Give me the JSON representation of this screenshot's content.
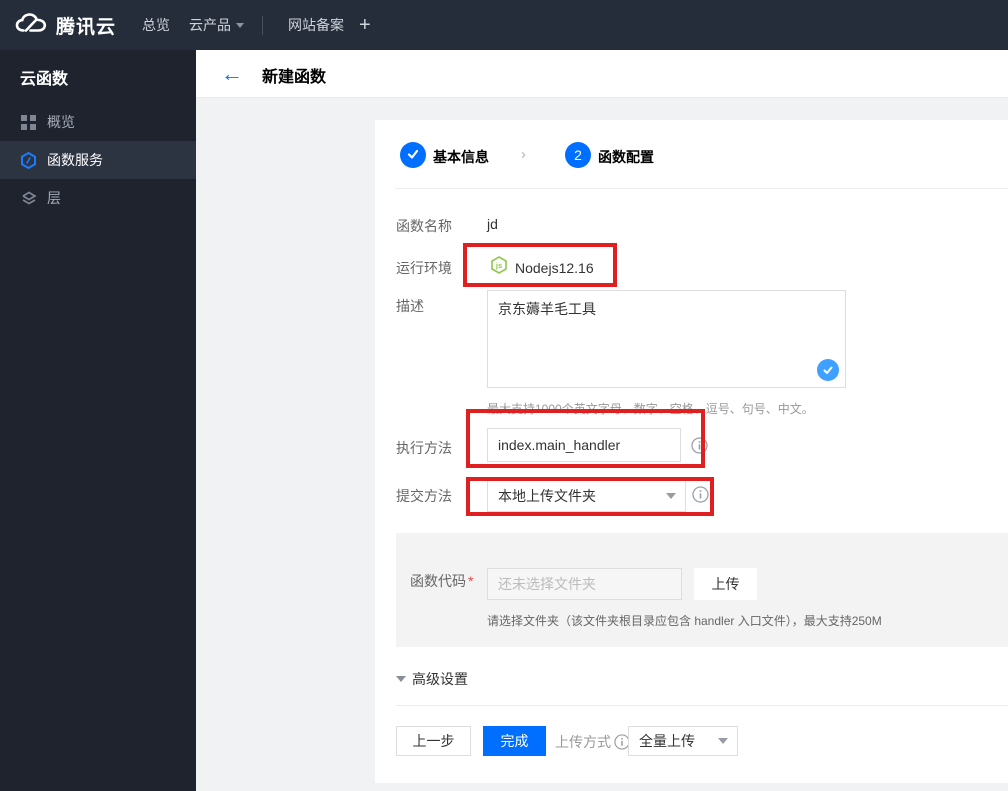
{
  "navbar": {
    "brand": "腾讯云",
    "overview": "总览",
    "cloud_products": "云产品",
    "icp_record": "网站备案",
    "plus": "+"
  },
  "sidebar": {
    "title": "云函数",
    "items": [
      {
        "label": "概览",
        "icon": "grid-icon"
      },
      {
        "label": "函数服务",
        "icon": "function-hexagon-icon",
        "selected": true
      },
      {
        "label": "层",
        "icon": "layers-icon"
      }
    ]
  },
  "header": {
    "back": "←",
    "title": "新建函数"
  },
  "steps": {
    "step1": {
      "label": "基本信息",
      "state": "done"
    },
    "step2": {
      "num": "2",
      "label": "函数配置",
      "state": "active"
    },
    "chevron": "›"
  },
  "form": {
    "function_name": {
      "label": "函数名称",
      "value": "jd"
    },
    "runtime": {
      "label": "运行环境",
      "value": "Nodejs12.16",
      "icon": "nodejs-icon"
    },
    "description": {
      "label": "描述",
      "value": "京东薅羊毛工具",
      "helper": "最大支持1000个英文字母、数字、空格、逗号、句号、中文。"
    },
    "handler": {
      "label": "执行方法",
      "value": "index.main_handler"
    },
    "submit_method": {
      "label": "提交方法",
      "value": "本地上传文件夹"
    },
    "function_code": {
      "label": "函数代码",
      "required_mark": "*",
      "placeholder": "还未选择文件夹",
      "upload_button": "上传",
      "helper": "请选择文件夹（该文件夹根目录应包含 handler 入口文件），最大支持250M"
    }
  },
  "advanced": {
    "label": "高级设置"
  },
  "footer": {
    "prev": "上一步",
    "finish": "完成",
    "upload_mode_label": "上传方式",
    "upload_mode_value": "全量上传"
  },
  "colors": {
    "accent_blue": "#006EFF",
    "annotation_red": "#E02020",
    "node_green": "#8CC84B",
    "check_badge_blue": "#40A0FF",
    "navbar_bg": "#252D3B",
    "sidebar_bg": "#1E232E",
    "sidebar_selected_bg": "#2C3442"
  }
}
